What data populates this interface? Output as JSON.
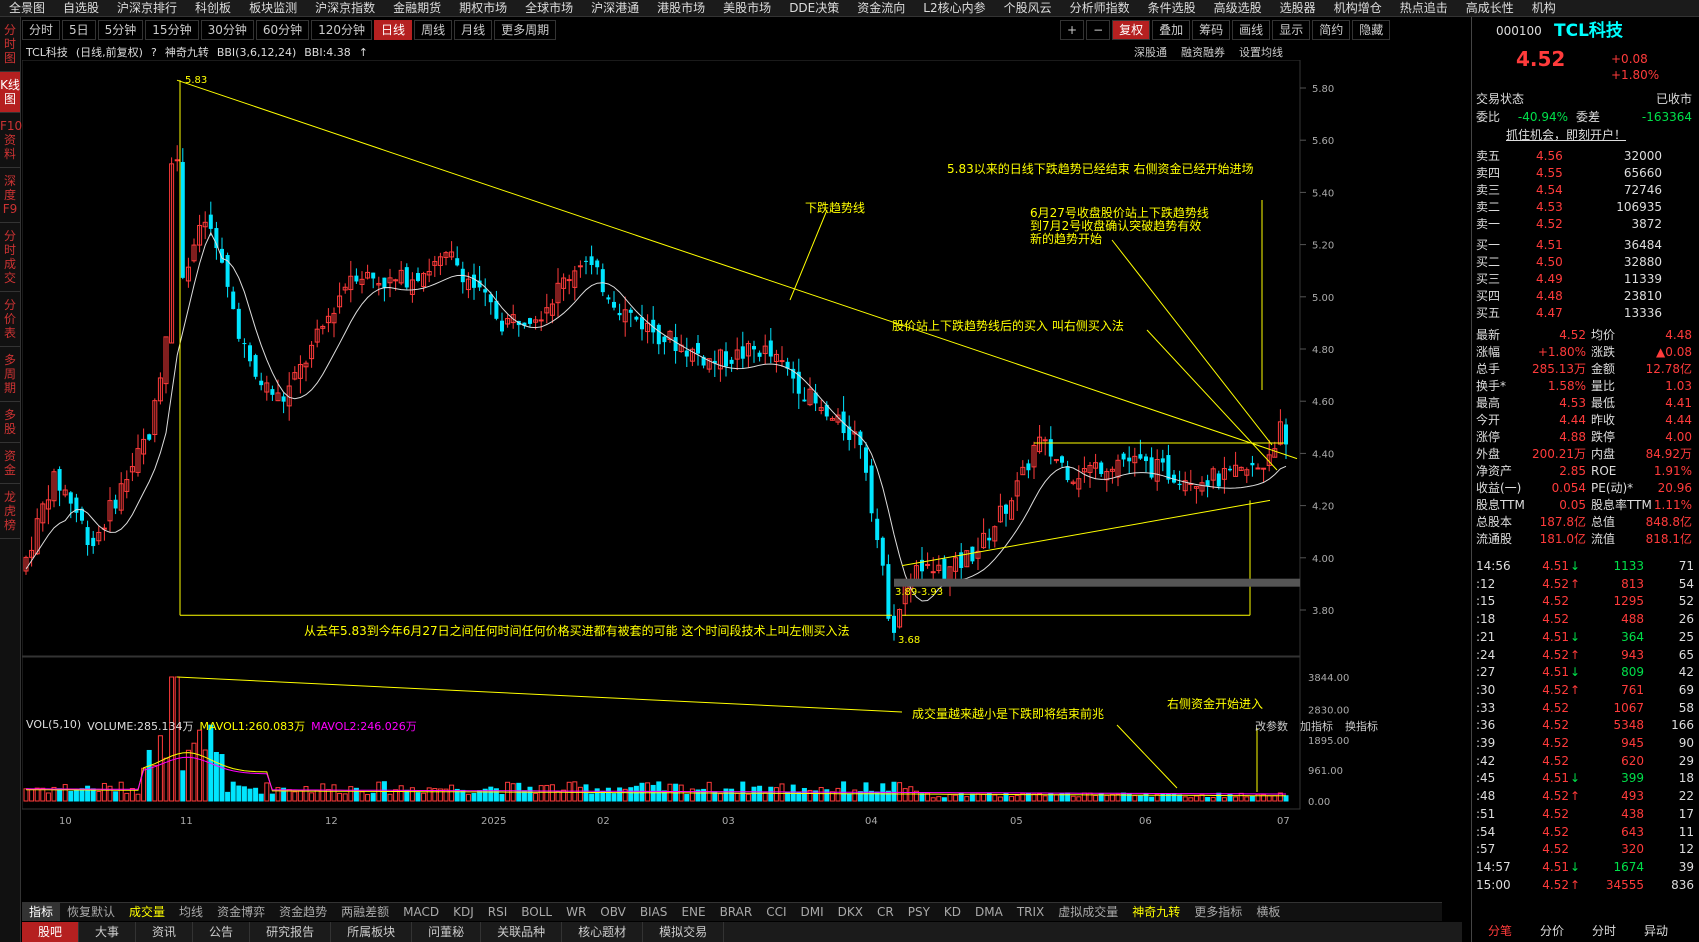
{
  "top_menu": [
    "全景图",
    "自选股",
    "沪深京排行",
    "科创板",
    "板块监测",
    "沪深京指数",
    "金融期货",
    "期权市场",
    "全球市场",
    "沪深港通",
    "港股市场",
    "美股市场",
    "DDE决策",
    "资金流向",
    "L2核心内参",
    "个股风云",
    "分析师指数",
    "条件选股",
    "高级选股",
    "选股器",
    "机构增仓",
    "热点追击",
    "高成长性",
    "机构"
  ],
  "left_tabs": [
    "分时图",
    "K线图",
    "F10资料",
    "深度F9",
    "分时成交",
    "分价表",
    "多周期",
    "多股",
    "资金",
    "龙虎榜"
  ],
  "period_tabs": [
    "分时",
    "5日",
    "5分钟",
    "15分钟",
    "30分钟",
    "60分钟",
    "120分钟",
    "日线",
    "周线",
    "月线",
    "更多周期"
  ],
  "right_tools": [
    "+",
    "−",
    "复权",
    "叠加",
    "筹码",
    "画线",
    "显示",
    "简约",
    "隐藏"
  ],
  "chart_header": {
    "name": "TCL科技",
    "mode": "(日线,前复权)",
    "help": "?",
    "ind": "神奇九转",
    "bbi": "BBI(3,6,12,24)",
    "bbi_val": "BBI:4.38"
  },
  "chart_tools": [
    "深股通",
    "融资融券",
    "设置均线"
  ],
  "vol_header": {
    "vol": "VOL(5,10)",
    "volume": "VOLUME:285.134万",
    "ma1": "MAVOL1:260.083万",
    "ma2": "MAVOL2:246.026万"
  },
  "vol_tools": [
    "改参数",
    "加指标",
    "换指标"
  ],
  "indicator_tabs": [
    "指标",
    "恢复默认",
    "成交量",
    "均线",
    "资金博弈",
    "资金趋势",
    "两融差额",
    "MACD",
    "KDJ",
    "RSI",
    "BOLL",
    "WR",
    "OBV",
    "BIAS",
    "ENE",
    "BRAR",
    "CCI",
    "DMI",
    "DKX",
    "CR",
    "PSY",
    "KD",
    "DMA",
    "TRIX",
    "虚拟成交量",
    "神奇九转",
    "更多指标",
    "横板"
  ],
  "bottom_tabs": [
    "股吧",
    "大事",
    "资讯",
    "公告",
    "研究报告",
    "所属板块",
    "问董秘",
    "关联品种",
    "核心题材",
    "模拟交易"
  ],
  "price_axis": [
    "5.80",
    "5.60",
    "5.40",
    "5.20",
    "5.00",
    "4.80",
    "4.60",
    "4.40",
    "4.20",
    "4.00",
    "3.80"
  ],
  "vol_axis": [
    "3844.00",
    "2830.00",
    "1895.00",
    "961.00",
    "0.00"
  ],
  "x_axis": [
    "10",
    "11",
    "12",
    "2025",
    "02",
    "03",
    "04",
    "05",
    "06",
    "07"
  ],
  "annotations": {
    "high": "5.83",
    "low": "3.68",
    "range": "3.89-3.93",
    "a1": "5.83以来的日线下跌趋势已经结束 右侧资金已经开始进场",
    "a2": "下跌趋势线",
    "a3_1": "6月27号收盘股价站上下跌趋势线",
    "a3_2": "到7月2号收盘确认突破趋势有效",
    "a3_3": "新的趋势开始",
    "a4": "股价站上下跌趋势线后的买入 叫右侧买入法",
    "a5": "从去年5.83到今年6月27日之间任何时间任何价格买进都有被套的可能 这个时间段技术上叫左侧买入法",
    "a6": "成交量越来越小是下跌即将结束前兆",
    "a7": "右侧资金开始进入"
  },
  "quote": {
    "code": "000100",
    "name": "TCL科技",
    "price": "4.52",
    "change": "+0.08",
    "pct": "+1.80%",
    "status_label": "交易状态",
    "status": "已收市",
    "wb_label": "委比",
    "wb": "-40.94%",
    "wc_label": "委差",
    "wc": "-163364",
    "promo": "抓住机会，即刻开户！",
    "asks": [
      {
        "l": "卖五",
        "p": "4.56",
        "v": "32000"
      },
      {
        "l": "卖四",
        "p": "4.55",
        "v": "65660"
      },
      {
        "l": "卖三",
        "p": "4.54",
        "v": "72746"
      },
      {
        "l": "卖二",
        "p": "4.53",
        "v": "106935"
      },
      {
        "l": "卖一",
        "p": "4.52",
        "v": "3872"
      }
    ],
    "bids": [
      {
        "l": "买一",
        "p": "4.51",
        "v": "36484"
      },
      {
        "l": "买二",
        "p": "4.50",
        "v": "32880"
      },
      {
        "l": "买三",
        "p": "4.49",
        "v": "11339"
      },
      {
        "l": "买四",
        "p": "4.48",
        "v": "23810"
      },
      {
        "l": "买五",
        "p": "4.47",
        "v": "13336"
      }
    ],
    "stats": [
      [
        "最新",
        "4.52",
        "均价",
        "4.48"
      ],
      [
        "涨幅",
        "+1.80%",
        "涨跌",
        "▲0.08"
      ],
      [
        "总手",
        "285.13万",
        "金额",
        "12.78亿"
      ],
      [
        "换手*",
        "1.58%",
        "量比",
        "1.03"
      ],
      [
        "最高",
        "4.53",
        "最低",
        "4.41"
      ],
      [
        "今开",
        "4.44",
        "昨收",
        "4.44"
      ],
      [
        "涨停",
        "4.88",
        "跌停",
        "4.00"
      ],
      [
        "外盘",
        "200.21万",
        "内盘",
        "84.92万"
      ],
      [
        "净资产",
        "2.85",
        "ROE",
        "1.91%"
      ],
      [
        "收益(一)",
        "0.054",
        "PE(动)*",
        "20.96"
      ],
      [
        "股息TTM",
        "0.05",
        "股息率TTM",
        "1.11%"
      ],
      [
        "总股本",
        "187.8亿",
        "总值",
        "848.8亿"
      ],
      [
        "流通股",
        "181.0亿",
        "流值",
        "818.1亿"
      ]
    ],
    "ticks": [
      [
        "14:56",
        "4.51",
        "↓",
        "1133",
        "71"
      ],
      [
        ":12",
        "4.52",
        "↑",
        "813",
        "54"
      ],
      [
        ":15",
        "4.52",
        "",
        "1295",
        "52"
      ],
      [
        ":18",
        "4.52",
        "",
        "488",
        "26"
      ],
      [
        ":21",
        "4.51",
        "↓",
        "364",
        "25"
      ],
      [
        ":24",
        "4.52",
        "↑",
        "943",
        "65"
      ],
      [
        ":27",
        "4.51",
        "↓",
        "809",
        "42"
      ],
      [
        ":30",
        "4.52",
        "↑",
        "761",
        "69"
      ],
      [
        ":33",
        "4.52",
        "",
        "1067",
        "58"
      ],
      [
        ":36",
        "4.52",
        "",
        "5348",
        "166"
      ],
      [
        ":39",
        "4.52",
        "",
        "945",
        "90"
      ],
      [
        ":42",
        "4.52",
        "",
        "620",
        "29"
      ],
      [
        ":45",
        "4.51",
        "↓",
        "399",
        "18"
      ],
      [
        ":48",
        "4.52",
        "↑",
        "493",
        "22"
      ],
      [
        ":51",
        "4.52",
        "",
        "438",
        "17"
      ],
      [
        ":54",
        "4.52",
        "",
        "643",
        "11"
      ],
      [
        ":57",
        "4.52",
        "",
        "320",
        "12"
      ],
      [
        "14:57",
        "4.51",
        "↓",
        "1674",
        "39"
      ],
      [
        "15:00",
        "4.52",
        "↑",
        "34555",
        "836"
      ]
    ],
    "footer_tabs": [
      "分笔",
      "分价",
      "分时",
      "异动"
    ]
  }
}
